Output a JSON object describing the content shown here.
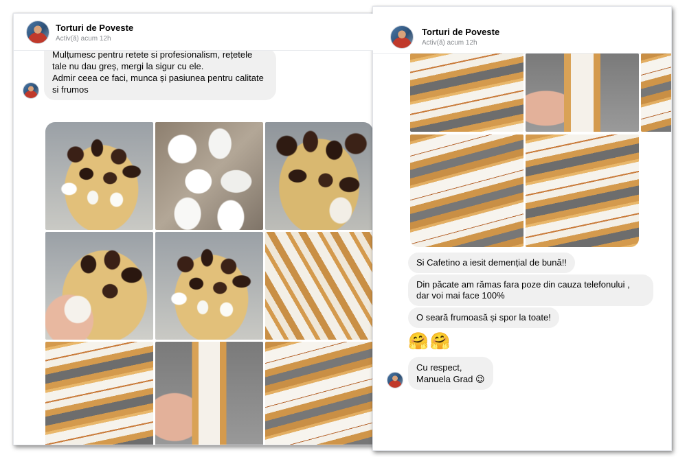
{
  "left_chat": {
    "name": "Torturi de Poveste",
    "status": "Activ(ă) acum 12h",
    "message": "Mulțumesc pentru retete si profesionalism, rețetele tale nu dau greș,  mergi la sigur cu ele.\nAdmir ceea ce faci, munca și pasiunea pentru calitate si frumos",
    "photos": [
      {
        "subject": "chocolate-meringues-plate"
      },
      {
        "subject": "white-meringues"
      },
      {
        "subject": "chocolate-meringues-cut"
      },
      {
        "subject": "chocolate-meringue-hand"
      },
      {
        "subject": "chocolate-meringues-board"
      },
      {
        "subject": "wafer-nougat-box"
      },
      {
        "subject": "wafer-nougat-stack"
      },
      {
        "subject": "wafer-nougat-hand"
      },
      {
        "subject": "wafer-nougat-slice"
      }
    ]
  },
  "right_chat": {
    "name": "Torturi de Poveste",
    "status": "Activ(ă) acum 12h",
    "messages": [
      "Si Cafetino a iesit demențial de bună!!",
      "Din păcate am rămas fara poze din cauza telefonului , dar voi mai face 100%",
      "O seară frumoasă și spor la toate!",
      "🤗🤗",
      "Cu respect,\nManuela Grad 😉"
    ]
  },
  "colors": {
    "bubble": "#f0f0f0",
    "status_text": "#8a8d91",
    "name_text": "#050505"
  }
}
